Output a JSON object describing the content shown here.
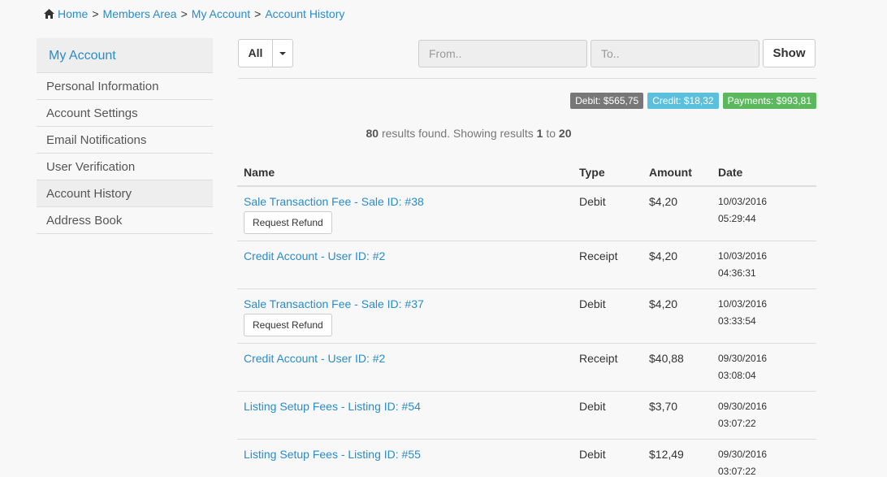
{
  "breadcrumb": [
    {
      "label": "Home"
    },
    {
      "label": "Members Area"
    },
    {
      "label": "My Account"
    },
    {
      "label": "Account History"
    }
  ],
  "sidebar": {
    "title": "My Account",
    "items": [
      {
        "label": "Personal Information"
      },
      {
        "label": "Account Settings"
      },
      {
        "label": "Email Notifications"
      },
      {
        "label": "User Verification"
      },
      {
        "label": "Account History",
        "active": true
      },
      {
        "label": "Address Book"
      }
    ]
  },
  "toolbar": {
    "filter_label": "All",
    "from_placeholder": "From..",
    "to_placeholder": "To..",
    "show_label": "Show"
  },
  "badges": {
    "debit": "Debit: $565,75",
    "credit": "Credit: $18,32",
    "payments": "Payments: $993,81"
  },
  "results": {
    "total": "80",
    "text1": "results found. Showing results",
    "from": "1",
    "to_word": "to",
    "to": "20"
  },
  "table": {
    "headers": [
      "Name",
      "Type",
      "Amount",
      "Date"
    ],
    "refund_label": "Request Refund",
    "rows": [
      {
        "name": "Sale Transaction Fee - Sale ID: #38",
        "type": "Debit",
        "amount": "$4,20",
        "date": "10/03/2016",
        "time": "05:29:44",
        "refund": true
      },
      {
        "name": "Credit Account - User ID: #2",
        "type": "Receipt",
        "amount": "$4,20",
        "date": "10/03/2016",
        "time": "04:36:31",
        "refund": false
      },
      {
        "name": "Sale Transaction Fee - Sale ID: #37",
        "type": "Debit",
        "amount": "$4,20",
        "date": "10/03/2016",
        "time": "03:33:54",
        "refund": true
      },
      {
        "name": "Credit Account - User ID: #2",
        "type": "Receipt",
        "amount": "$40,88",
        "date": "09/30/2016",
        "time": "03:08:04",
        "refund": false
      },
      {
        "name": "Listing Setup Fees - Listing ID: #54",
        "type": "Debit",
        "amount": "$3,70",
        "date": "09/30/2016",
        "time": "03:07:22",
        "refund": false
      },
      {
        "name": "Listing Setup Fees - Listing ID: #55",
        "type": "Debit",
        "amount": "$12,49",
        "date": "09/30/2016",
        "time": "03:07:22",
        "refund": false
      }
    ]
  }
}
